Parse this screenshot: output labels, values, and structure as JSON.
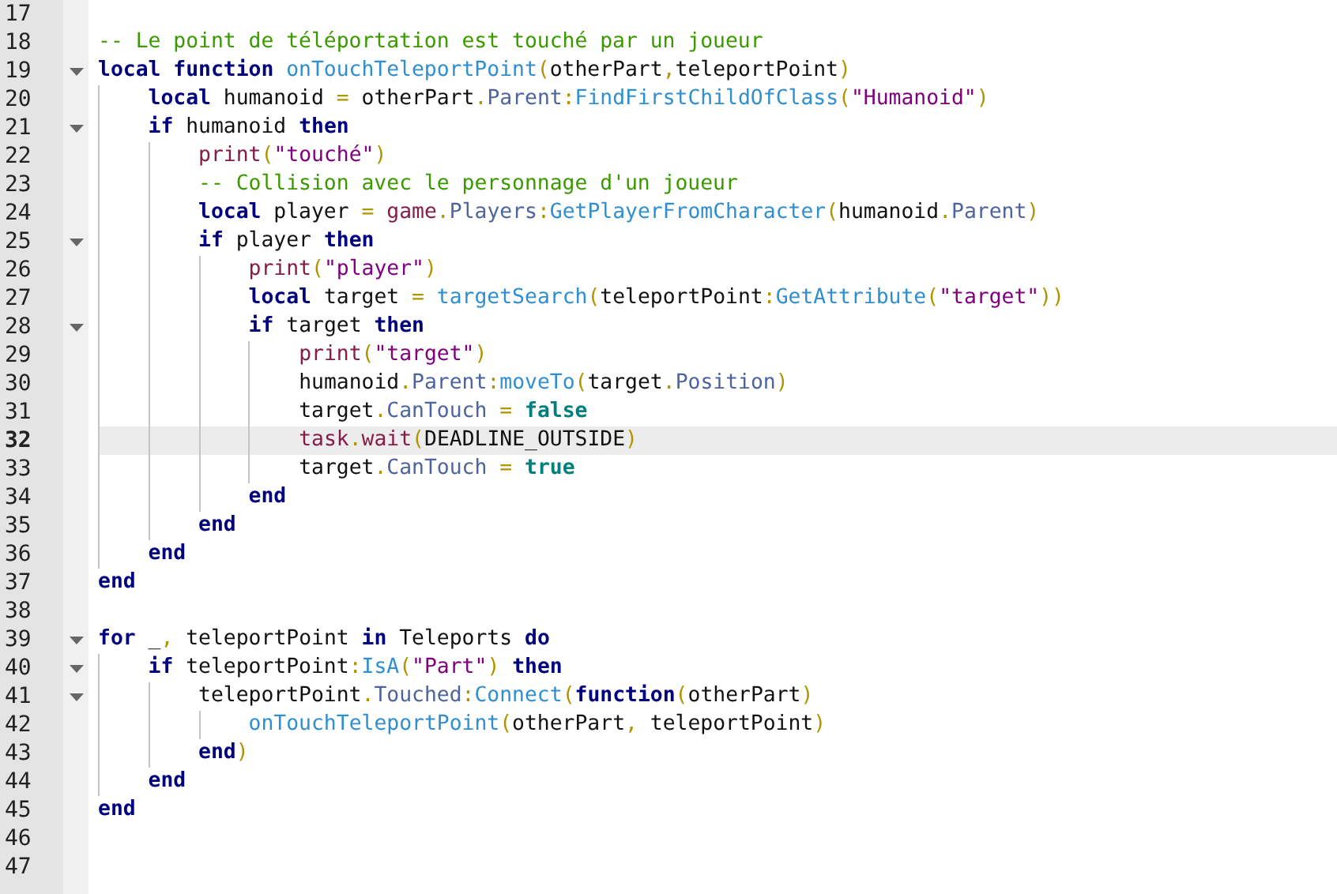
{
  "editor": {
    "lines": [
      {
        "number": "17",
        "current": false
      },
      {
        "number": "18",
        "current": false,
        "tokens": [
          {
            "text": "-- Le point de téléportation est touché par un joueur",
            "kind": "comment"
          }
        ]
      },
      {
        "number": "19",
        "current": false,
        "expanded": true,
        "tokens": [
          {
            "text": "local function ",
            "kind": "keyword"
          },
          {
            "text": "onTouchTeleportPoint",
            "kind": "method"
          },
          {
            "text": "(",
            "kind": "punct"
          },
          {
            "text": "otherPart",
            "kind": "plain"
          },
          {
            "text": ",",
            "kind": "punct"
          },
          {
            "text": "teleportPoint",
            "kind": "plain"
          },
          {
            "text": ")",
            "kind": "punct"
          }
        ]
      },
      {
        "number": "20",
        "current": false,
        "tokens": [
          {
            "text": "    local",
            "kind": "keyword"
          },
          {
            "text": " humanoid ",
            "kind": "plain"
          },
          {
            "text": "=",
            "kind": "punct"
          },
          {
            "text": " otherPart",
            "kind": "plain"
          },
          {
            "text": ".",
            "kind": "punct"
          },
          {
            "text": "Parent",
            "kind": "field"
          },
          {
            "text": ":",
            "kind": "punct"
          },
          {
            "text": "FindFirstChildOfClass",
            "kind": "method"
          },
          {
            "text": "(",
            "kind": "punct"
          },
          {
            "text": "\"Humanoid\"",
            "kind": "string"
          },
          {
            "text": ")",
            "kind": "punct"
          }
        ]
      },
      {
        "number": "21",
        "current": false,
        "expanded": true,
        "tokens": [
          {
            "text": "    if",
            "kind": "keyword"
          },
          {
            "text": " humanoid ",
            "kind": "plain"
          },
          {
            "text": "then",
            "kind": "keyword"
          }
        ]
      },
      {
        "number": "22",
        "current": false,
        "tokens": [
          {
            "text": "        print",
            "kind": "builtin"
          },
          {
            "text": "(",
            "kind": "punct"
          },
          {
            "text": "\"touché\"",
            "kind": "string"
          },
          {
            "text": ")",
            "kind": "punct"
          }
        ]
      },
      {
        "number": "23",
        "current": false,
        "tokens": [
          {
            "text": "        -- Collision avec le personnage d'un joueur",
            "kind": "comment"
          }
        ]
      },
      {
        "number": "24",
        "current": false,
        "tokens": [
          {
            "text": "        local",
            "kind": "keyword"
          },
          {
            "text": " player ",
            "kind": "plain"
          },
          {
            "text": "=",
            "kind": "punct"
          },
          {
            "text": " game",
            "kind": "builtin"
          },
          {
            "text": ".",
            "kind": "punct"
          },
          {
            "text": "Players",
            "kind": "field"
          },
          {
            "text": ":",
            "kind": "punct"
          },
          {
            "text": "GetPlayerFromCharacter",
            "kind": "method"
          },
          {
            "text": "(",
            "kind": "punct"
          },
          {
            "text": "humanoid",
            "kind": "plain"
          },
          {
            "text": ".",
            "kind": "punct"
          },
          {
            "text": "Parent",
            "kind": "field"
          },
          {
            "text": ")",
            "kind": "punct"
          }
        ]
      },
      {
        "number": "25",
        "current": false,
        "expanded": true,
        "tokens": [
          {
            "text": "        if",
            "kind": "keyword"
          },
          {
            "text": " player ",
            "kind": "plain"
          },
          {
            "text": "then",
            "kind": "keyword"
          }
        ]
      },
      {
        "number": "26",
        "current": false,
        "tokens": [
          {
            "text": "            print",
            "kind": "builtin"
          },
          {
            "text": "(",
            "kind": "punct"
          },
          {
            "text": "\"player\"",
            "kind": "string"
          },
          {
            "text": ")",
            "kind": "punct"
          }
        ]
      },
      {
        "number": "27",
        "current": false,
        "tokens": [
          {
            "text": "            local",
            "kind": "keyword"
          },
          {
            "text": " target ",
            "kind": "plain"
          },
          {
            "text": "=",
            "kind": "punct"
          },
          {
            "text": " targetSearch",
            "kind": "method"
          },
          {
            "text": "(",
            "kind": "punct"
          },
          {
            "text": "teleportPoint",
            "kind": "plain"
          },
          {
            "text": ":",
            "kind": "punct"
          },
          {
            "text": "GetAttribute",
            "kind": "method"
          },
          {
            "text": "(",
            "kind": "punct"
          },
          {
            "text": "\"target\"",
            "kind": "string"
          },
          {
            "text": "))",
            "kind": "punct"
          }
        ]
      },
      {
        "number": "28",
        "current": false,
        "expanded": true,
        "tokens": [
          {
            "text": "            if",
            "kind": "keyword"
          },
          {
            "text": " target ",
            "kind": "plain"
          },
          {
            "text": "then",
            "kind": "keyword"
          }
        ]
      },
      {
        "number": "29",
        "current": false,
        "tokens": [
          {
            "text": "                print",
            "kind": "builtin"
          },
          {
            "text": "(",
            "kind": "punct"
          },
          {
            "text": "\"target\"",
            "kind": "string"
          },
          {
            "text": ")",
            "kind": "punct"
          }
        ]
      },
      {
        "number": "30",
        "current": false,
        "tokens": [
          {
            "text": "                humanoid",
            "kind": "plain"
          },
          {
            "text": ".",
            "kind": "punct"
          },
          {
            "text": "Parent",
            "kind": "field"
          },
          {
            "text": ":",
            "kind": "punct"
          },
          {
            "text": "moveTo",
            "kind": "method"
          },
          {
            "text": "(",
            "kind": "punct"
          },
          {
            "text": "target",
            "kind": "plain"
          },
          {
            "text": ".",
            "kind": "punct"
          },
          {
            "text": "Position",
            "kind": "field"
          },
          {
            "text": ")",
            "kind": "punct"
          }
        ]
      },
      {
        "number": "31",
        "current": false,
        "tokens": [
          {
            "text": "                target",
            "kind": "plain"
          },
          {
            "text": ".",
            "kind": "punct"
          },
          {
            "text": "CanTouch ",
            "kind": "field"
          },
          {
            "text": "= ",
            "kind": "punct"
          },
          {
            "text": "false",
            "kind": "literal"
          }
        ]
      },
      {
        "number": "32",
        "current": true,
        "tokens": [
          {
            "text": "                task",
            "kind": "builtin"
          },
          {
            "text": ".",
            "kind": "punct"
          },
          {
            "text": "wait",
            "kind": "builtin"
          },
          {
            "text": "(",
            "kind": "punct"
          },
          {
            "text": "DEADLINE_OUTSIDE",
            "kind": "plain"
          },
          {
            "text": ")",
            "kind": "punct"
          }
        ]
      },
      {
        "number": "33",
        "current": false,
        "tokens": [
          {
            "text": "                target",
            "kind": "plain"
          },
          {
            "text": ".",
            "kind": "punct"
          },
          {
            "text": "CanTouch ",
            "kind": "field"
          },
          {
            "text": "= ",
            "kind": "punct"
          },
          {
            "text": "true",
            "kind": "literal"
          }
        ]
      },
      {
        "number": "34",
        "current": false,
        "tokens": [
          {
            "text": "            end",
            "kind": "keyword"
          }
        ]
      },
      {
        "number": "35",
        "current": false,
        "tokens": [
          {
            "text": "        end",
            "kind": "keyword"
          }
        ]
      },
      {
        "number": "36",
        "current": false,
        "tokens": [
          {
            "text": "    end",
            "kind": "keyword"
          }
        ]
      },
      {
        "number": "37",
        "current": false,
        "tokens": [
          {
            "text": "end",
            "kind": "keyword"
          }
        ]
      },
      {
        "number": "38",
        "current": false
      },
      {
        "number": "39",
        "current": false,
        "expanded": true,
        "tokens": [
          {
            "text": "for",
            "kind": "keyword"
          },
          {
            "text": " _",
            "kind": "plain"
          },
          {
            "text": ",",
            "kind": "punct"
          },
          {
            "text": " teleportPoint ",
            "kind": "plain"
          },
          {
            "text": "in",
            "kind": "keyword"
          },
          {
            "text": " Teleports ",
            "kind": "plain"
          },
          {
            "text": "do",
            "kind": "keyword"
          }
        ]
      },
      {
        "number": "40",
        "current": false,
        "expanded": true,
        "tokens": [
          {
            "text": "    if",
            "kind": "keyword"
          },
          {
            "text": " teleportPoint",
            "kind": "plain"
          },
          {
            "text": ":",
            "kind": "punct"
          },
          {
            "text": "IsA",
            "kind": "method"
          },
          {
            "text": "(",
            "kind": "punct"
          },
          {
            "text": "\"Part\"",
            "kind": "string"
          },
          {
            "text": ") ",
            "kind": "punct"
          },
          {
            "text": "then",
            "kind": "keyword"
          }
        ]
      },
      {
        "number": "41",
        "current": false,
        "expanded": true,
        "tokens": [
          {
            "text": "        teleportPoint",
            "kind": "plain"
          },
          {
            "text": ".",
            "kind": "punct"
          },
          {
            "text": "Touched",
            "kind": "field"
          },
          {
            "text": ":",
            "kind": "punct"
          },
          {
            "text": "Connect",
            "kind": "method"
          },
          {
            "text": "(",
            "kind": "punct"
          },
          {
            "text": "function",
            "kind": "keyword"
          },
          {
            "text": "(",
            "kind": "punct"
          },
          {
            "text": "otherPart",
            "kind": "plain"
          },
          {
            "text": ")",
            "kind": "punct"
          }
        ]
      },
      {
        "number": "42",
        "current": false,
        "tokens": [
          {
            "text": "            onTouchTeleportPoint",
            "kind": "method"
          },
          {
            "text": "(",
            "kind": "punct"
          },
          {
            "text": "otherPart",
            "kind": "plain"
          },
          {
            "text": ",",
            "kind": "punct"
          },
          {
            "text": " teleportPoint",
            "kind": "plain"
          },
          {
            "text": ")",
            "kind": "punct"
          }
        ]
      },
      {
        "number": "43",
        "current": false,
        "tokens": [
          {
            "text": "        end",
            "kind": "keyword"
          },
          {
            "text": ")",
            "kind": "punct"
          }
        ]
      },
      {
        "number": "44",
        "current": false,
        "tokens": [
          {
            "text": "    end",
            "kind": "keyword"
          }
        ]
      },
      {
        "number": "45",
        "current": false,
        "tokens": [
          {
            "text": "end",
            "kind": "keyword"
          }
        ]
      },
      {
        "number": "46",
        "current": false
      },
      {
        "number": "47",
        "current": false
      }
    ]
  }
}
